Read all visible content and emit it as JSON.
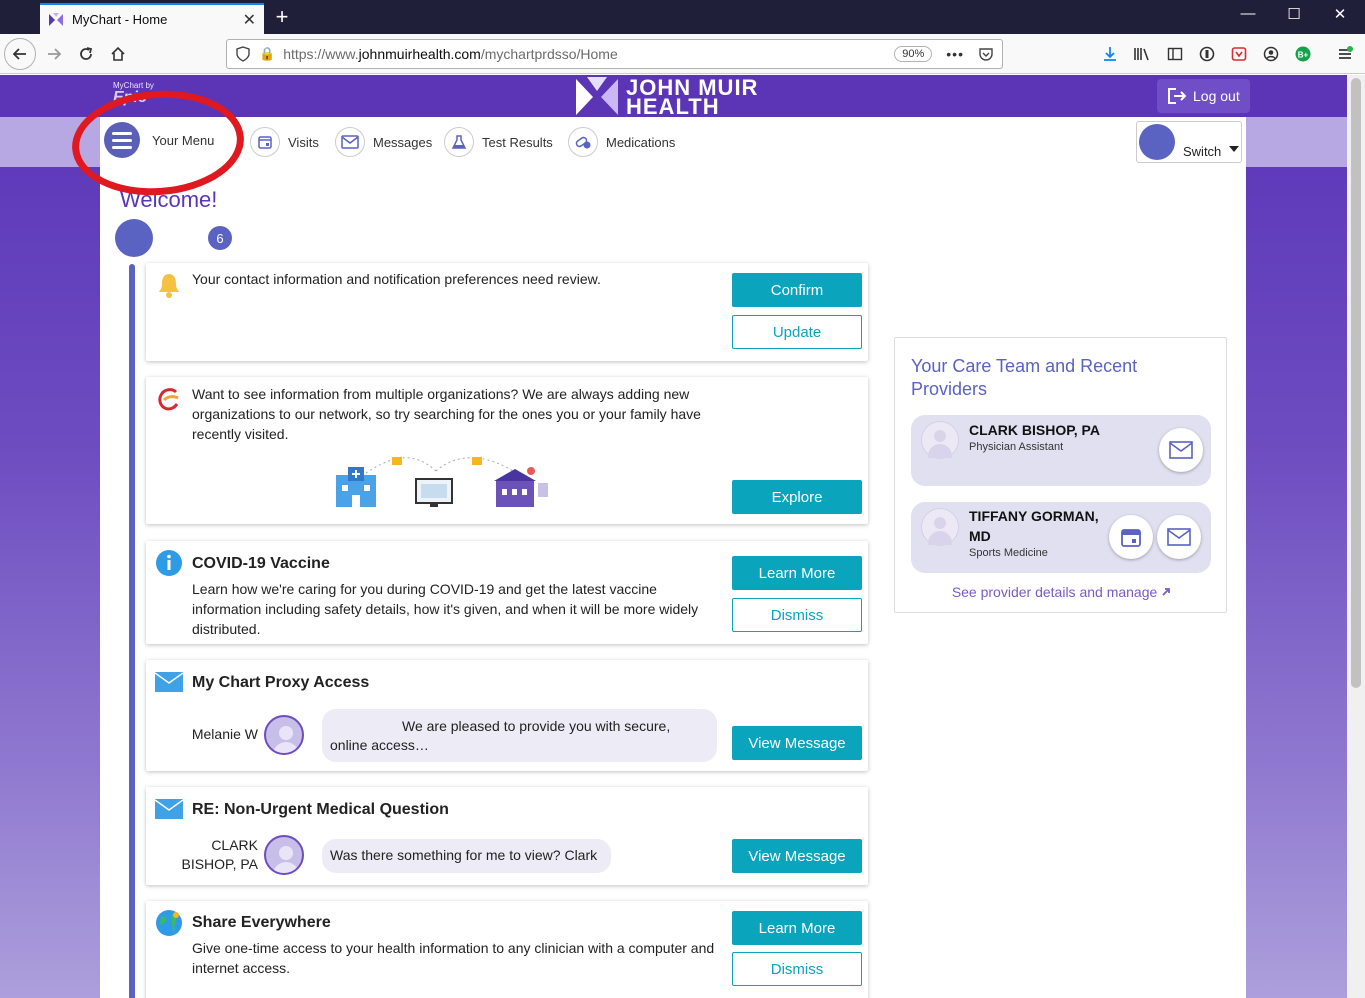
{
  "browser": {
    "tab_title": "MyChart - Home",
    "url_prefix": "https://www.",
    "url_domain": "johnmuirhealth.com",
    "url_path": "/mychartprdsso/Home",
    "zoom": "90%"
  },
  "header": {
    "mychart_by": "MyChart by",
    "epic": "Epic",
    "brand_line1": "JOHN MUIR",
    "brand_line2": "HEALTH",
    "logout_label": "Log out"
  },
  "menu": {
    "your_menu": "Your Menu",
    "visits": "Visits",
    "messages": "Messages",
    "test_results": "Test Results",
    "medications": "Medications",
    "switch": "Switch"
  },
  "welcome": {
    "title": "Welcome!",
    "count": "6"
  },
  "cards": {
    "contact": {
      "text": "Your contact information and notification preferences need review.",
      "confirm": "Confirm",
      "update": "Update"
    },
    "orgs": {
      "text": "Want to see information from multiple organizations? We are always adding new organizations to our network, so try searching for the ones you or your family have recently visited.",
      "explore": "Explore"
    },
    "covid": {
      "title": "COVID-19 Vaccine",
      "text": "Learn how we're caring for you during COVID-19 and get the latest vaccine information including safety details, how it's given, and when it will be more widely distributed.",
      "learn_more": "Learn More",
      "dismiss": "Dismiss"
    },
    "proxy": {
      "title": "My Chart Proxy Access",
      "sender": "Melanie W",
      "message": "We are pleased to provide you with secure, online access…",
      "view": "View Message"
    },
    "question": {
      "title": "RE: Non-Urgent Medical Question",
      "sender_line1": "CLARK",
      "sender_line2": "BISHOP, PA",
      "message": "Was there something for me to view? Clark",
      "view": "View Message"
    },
    "share": {
      "title": "Share Everywhere",
      "text": "Give one-time access to your health information to any clinician with a computer and internet access.",
      "learn_more": "Learn More",
      "dismiss": "Dismiss"
    }
  },
  "care_team": {
    "title": "Your Care Team and Recent Providers",
    "providers": [
      {
        "name": "CLARK BISHOP, PA",
        "role": "Physician Assistant"
      },
      {
        "name_line1": "TIFFANY GORMAN,",
        "name_line2": "MD",
        "role": "Sports Medicine"
      }
    ],
    "link": "See provider details and manage"
  },
  "colors": {
    "brand_purple": "#5a35b9",
    "accent_teal": "#0aa4bd",
    "avatar_blue": "#5a62c2",
    "annotation_red": "#e0181f"
  }
}
